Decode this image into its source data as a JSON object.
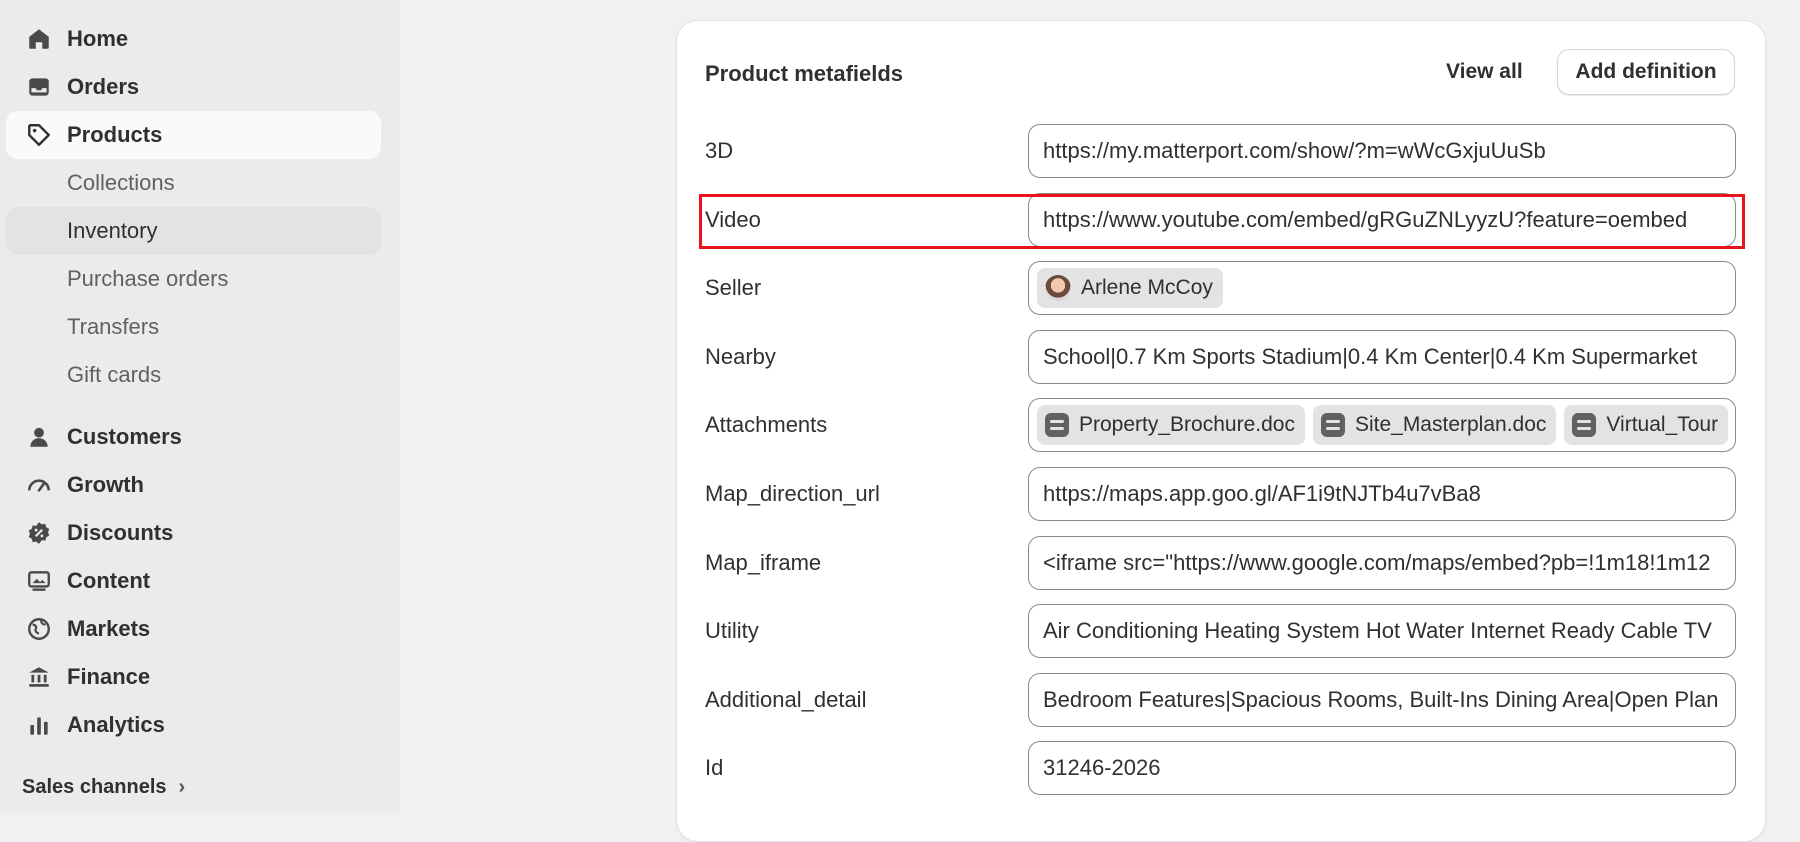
{
  "sidebar": {
    "items": [
      {
        "label": "Home",
        "icon": "home-icon"
      },
      {
        "label": "Orders",
        "icon": "inbox-icon"
      },
      {
        "label": "Products",
        "icon": "tag-icon"
      },
      {
        "label": "Collections"
      },
      {
        "label": "Inventory"
      },
      {
        "label": "Purchase orders"
      },
      {
        "label": "Transfers"
      },
      {
        "label": "Gift cards"
      },
      {
        "label": "Customers",
        "icon": "person-icon"
      },
      {
        "label": "Growth",
        "icon": "gauge-icon"
      },
      {
        "label": "Discounts",
        "icon": "discount-badge-icon"
      },
      {
        "label": "Content",
        "icon": "image-icon"
      },
      {
        "label": "Markets",
        "icon": "globe-icon"
      },
      {
        "label": "Finance",
        "icon": "bank-icon"
      },
      {
        "label": "Analytics",
        "icon": "bar-chart-icon"
      }
    ],
    "sales_channels": "Sales channels"
  },
  "metafields": {
    "title": "Product metafields",
    "view_all": "View all",
    "add_definition": "Add definition",
    "rows": [
      {
        "label": "3D",
        "value": "https://my.matterport.com/show/?m=wWcGxjuUuSb"
      },
      {
        "label": "Video",
        "value": "https://www.youtube.com/embed/gRGuZNLyyzU?feature=oembed"
      },
      {
        "label": "Seller",
        "value": "Arlene McCoy"
      },
      {
        "label": "Nearby",
        "value": "School|0.7 Km Sports Stadium|0.4 Km Center|0.4 Km Supermarket"
      },
      {
        "label": "Attachments",
        "files": [
          "Property_Brochure.doc",
          "Site_Masterplan.doc",
          "Virtual_Tour"
        ]
      },
      {
        "label": "Map_direction_url",
        "value": "https://maps.app.goo.gl/AF1i9tNJTb4u7vBa8"
      },
      {
        "label": "Map_iframe",
        "value": "<iframe src=\"https://www.google.com/maps/embed?pb=!1m18!1m12"
      },
      {
        "label": "Utility",
        "value": "Air Conditioning Heating System Hot Water Internet Ready Cable TV"
      },
      {
        "label": "Additional_detail",
        "value": "Bedroom Features|Spacious Rooms, Built-Ins Dining Area|Open Plan"
      },
      {
        "label": "Id",
        "value": "31246-2026"
      }
    ]
  },
  "colors": {
    "highlight": "#e8131b",
    "sidebar_bg": "#ebebeb",
    "page_bg": "#f1f1f1"
  }
}
